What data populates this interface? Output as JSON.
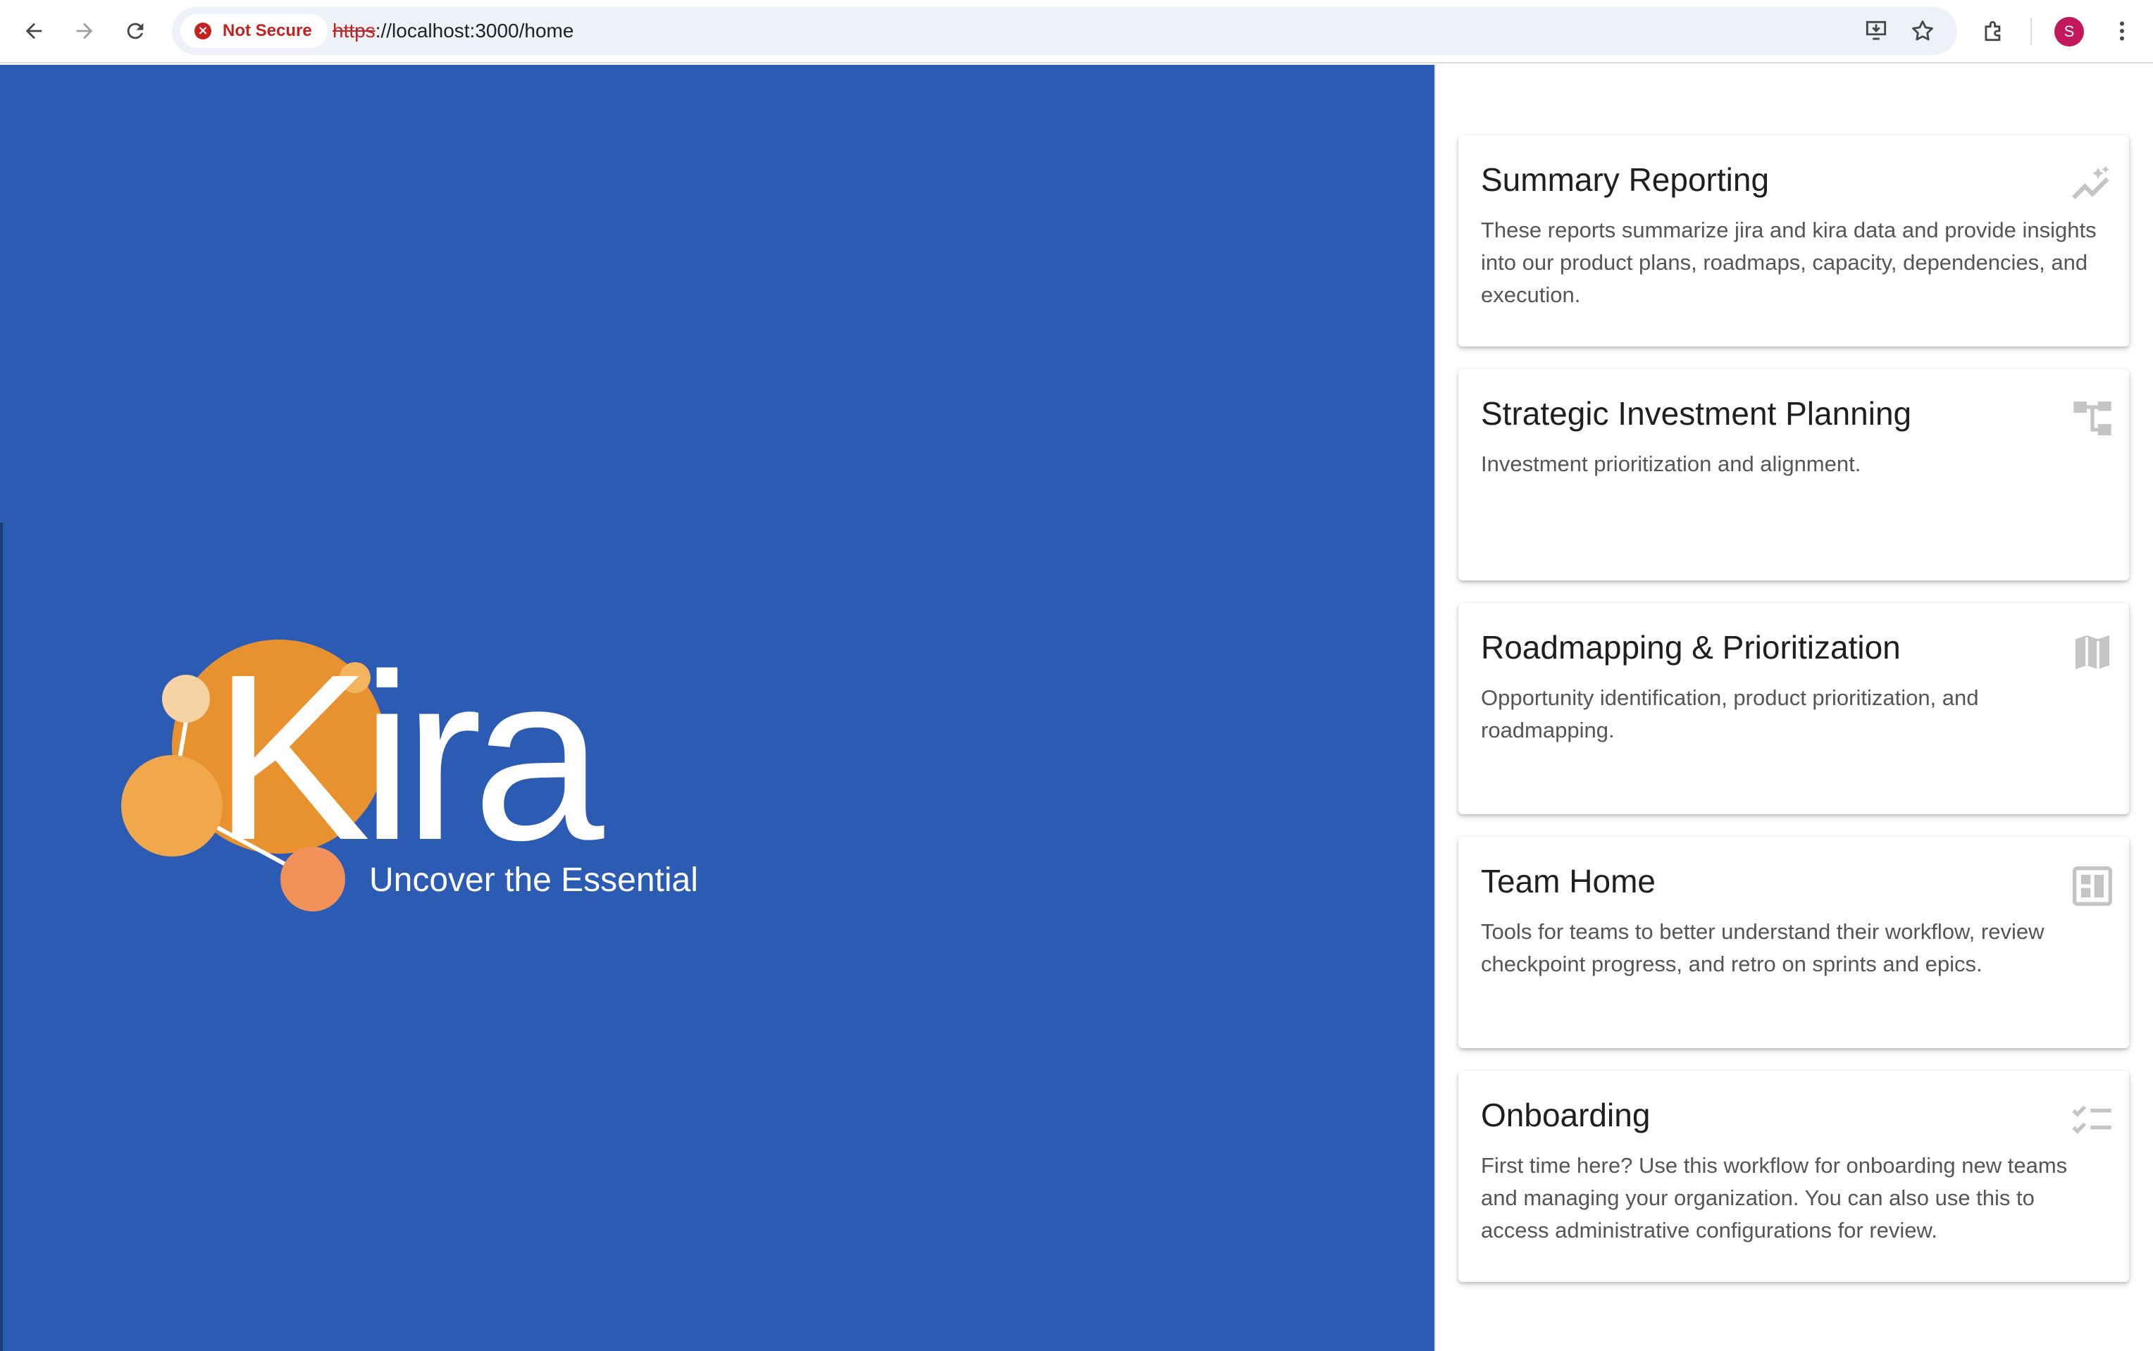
{
  "browser": {
    "security_label": "Not Secure",
    "url_scheme": "https",
    "url_rest": "://localhost:3000/home",
    "profile_initial": "S"
  },
  "hero": {
    "logo_text": "Kira",
    "tagline": "Uncover the Essential",
    "background": "#2c5bb4",
    "accent_orange": "#e8922f"
  },
  "cards": [
    {
      "title": "Summary Reporting",
      "description": "These reports summarize jira and kira data and provide insights into our product plans, roadmaps, capacity, dependencies, and execution.",
      "icon": "auto-graph-icon"
    },
    {
      "title": "Strategic Investment Planning",
      "description": "Investment prioritization and alignment.",
      "icon": "account-tree-icon"
    },
    {
      "title": "Roadmapping & Prioritization",
      "description": "Opportunity identification, product prioritization, and roadmapping.",
      "icon": "map-icon"
    },
    {
      "title": "Team Home",
      "description": "Tools for teams to better understand their workflow, review checkpoint progress, and retro on sprints and epics.",
      "icon": "dashboard-icon"
    },
    {
      "title": "Onboarding",
      "description": "First time here? Use this workflow for onboarding new teams and managing your organization. You can also use this to access administrative configurations for review.",
      "icon": "checklist-icon"
    }
  ]
}
